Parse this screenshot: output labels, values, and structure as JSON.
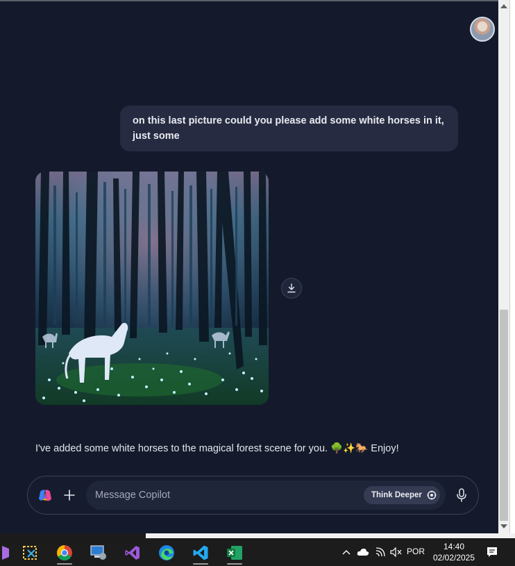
{
  "chat": {
    "user_message": "on this last picture could you please add some white horses in it, just some",
    "assistant_reply": "I've added some white horses to the magical forest scene for you. 🌳✨🐎 Enjoy!"
  },
  "composer": {
    "placeholder": "Message Copilot",
    "think_deeper_label": "Think Deeper"
  },
  "taskbar": {
    "language": "POR",
    "time": "14:40",
    "date": "02/02/2025"
  },
  "icons": {
    "avatar": "user-avatar",
    "download": "download-icon",
    "copilot": "copilot-logo-icon",
    "plus": "plus-icon",
    "think_deeper": "think-deeper-icon",
    "mic": "microphone-icon"
  },
  "colors": {
    "background": "#141a2b",
    "bubble": "#262b41",
    "input": "#20263a",
    "think_button": "#343b53"
  }
}
